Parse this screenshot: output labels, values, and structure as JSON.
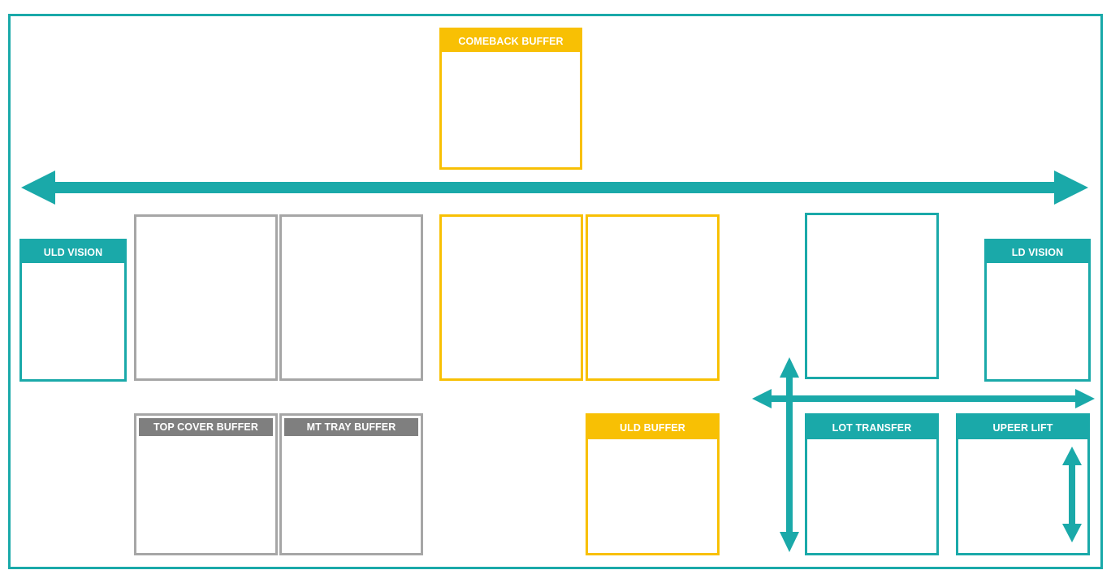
{
  "colors": {
    "teal": "#1aa9a9",
    "yellow": "#f8c004",
    "gray_border": "#a6a6a6",
    "gray_header": "#7f7f7f"
  },
  "stations": {
    "comeback_buffer": "COMEBACK BUFFER",
    "uld_vision": "ULD VISION",
    "ld_vision": "LD VISION",
    "top_cover_buffer": "TOP COVER BUFFER",
    "mt_tray_buffer": "MT TRAY BUFFER",
    "uld_buffer": "ULD BUFFER",
    "lot_transfer": "LOT TRANSFER",
    "upper_lift": "UPEER LIFT"
  },
  "arrows": {
    "main_rail": "double-arrow-horizontal",
    "transfer_rail": "double-arrow-horizontal",
    "transfer_vertical": "double-arrow-vertical",
    "lift_vertical": "double-arrow-vertical"
  }
}
